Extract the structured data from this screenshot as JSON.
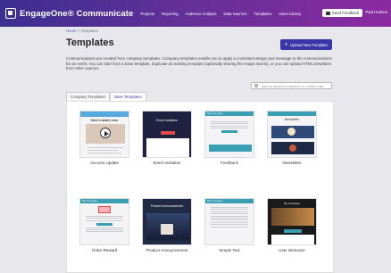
{
  "app": {
    "brand": "EngageOne® Communicate",
    "nav": [
      "Projects",
      "Reporting",
      "Audience Analysis",
      "Data Sources",
      "Templates",
      "Asset Library"
    ],
    "feedback_label": "Send Feedback",
    "user_name": "Paul Hudson"
  },
  "breadcrumb": {
    "home": "Home",
    "sep": ">",
    "current": "Templates"
  },
  "page": {
    "title": "Templates",
    "upload_label": "Upload New Template",
    "description": "Communications are created from company templates. Company templates enable you to apply a consistent design and message to the communications for an event. You can start from a base template, duplicate an existing template (optionally sharing the image assets), or you can upload HTML templates from other sources."
  },
  "search": {
    "placeholder": "Type to search templates or content tab"
  },
  "tabs": [
    {
      "label": "Company Templates",
      "active": false
    },
    {
      "label": "Base Templates",
      "active": true
    }
  ],
  "templates": [
    {
      "caption": "Account Update",
      "thumb_title": "Here's what's new"
    },
    {
      "caption": "Event Invitation",
      "thumb_title": "Event Invitation"
    },
    {
      "caption": "Feedback",
      "thumb_title": "My Company"
    },
    {
      "caption": "Newsletter",
      "thumb_title": "Newsletter"
    },
    {
      "caption": "Order Reward",
      "thumb_title": "My Company"
    },
    {
      "caption": "Product Announcement",
      "thumb_title": "Product Announcement"
    },
    {
      "caption": "Simple Text",
      "thumb_title": "My Company"
    },
    {
      "caption": "User Welcome",
      "thumb_title": "My Company"
    }
  ]
}
